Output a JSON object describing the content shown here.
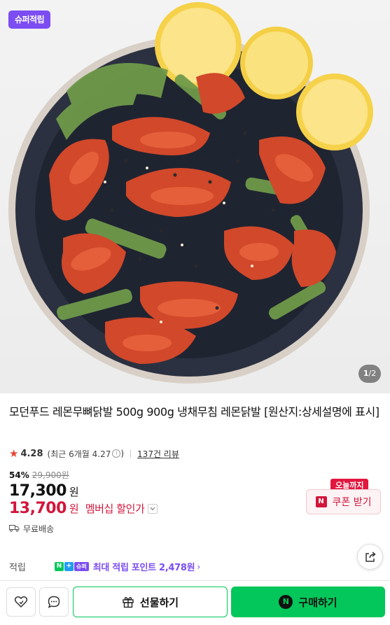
{
  "hero": {
    "badge": "슈퍼적립",
    "counter_current": "1",
    "counter_total": "2",
    "image_subject": "spicy seasoned chicken feet on dark plate with lemon slices and green vegetables"
  },
  "product": {
    "title": "모던푸드 레몬무뼈닭발 500g 900g 냉채무침 레몬닭발 [원산지:상세설명에 표시]",
    "rating": "4.28",
    "rating_recent": "(최근 6개월 4.27",
    "rating_recent_close": ")",
    "review_link": "137건 리뷰"
  },
  "pricing": {
    "discount_pct": "54%",
    "original_price": "29,900원",
    "price": "17,300",
    "won": "원",
    "member_price": "13,700",
    "member_won": "원",
    "member_label": "멤버십 할인가"
  },
  "coupon": {
    "today_badge": "오늘까지",
    "icon_letter": "N",
    "button_label": "쿠폰 받기"
  },
  "shipping": {
    "label": "무료배송"
  },
  "points": {
    "label": "적립",
    "badge_n": "N",
    "badge_plus": "+",
    "badge_super": "슈퍼",
    "text": "최대 적립 포인트 2,478원"
  },
  "bottom_bar": {
    "gift_label": "선물하기",
    "buy_icon_letter": "N",
    "buy_label": "구매하기"
  },
  "colors": {
    "brand_green": "#03c75a",
    "super_purple": "#7b4df2",
    "sale_red": "#d2163b",
    "star_red": "#e8412f"
  },
  "icons": [
    "heart-plus-icon",
    "chat-bubble-icon",
    "gift-icon",
    "share-icon",
    "truck-icon",
    "star-icon",
    "info-icon",
    "chevron-down-icon",
    "chevron-right-icon"
  ]
}
